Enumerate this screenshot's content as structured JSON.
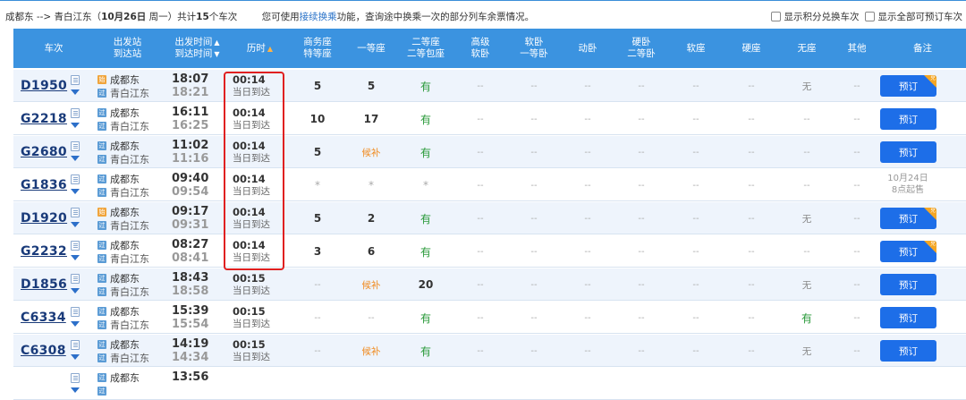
{
  "top": {
    "route_prefix": "成都东 --> 青白江东（",
    "route_date": "10月26日",
    "route_mid": " 周一）共计",
    "route_count": "15",
    "route_suffix": "个车次",
    "notice_prefix": "您可使用",
    "notice_link": "接续换乘",
    "notice_suffix": "功能，查询途中换乘一次的部分列车余票情况。",
    "opt_points": "显示积分兑换车次",
    "opt_all": "显示全部可预订车次"
  },
  "headers": {
    "train": "车次",
    "station_1": "出发站",
    "station_2": "到达站",
    "time_1": "出发时间",
    "time_2": "到达时间",
    "duration": "历时",
    "business_1": "商务座",
    "business_2": "特等座",
    "first": "一等座",
    "second_1": "二等座",
    "second_2": "二等包座",
    "advsoft_1": "高级",
    "advsoft_2": "软卧",
    "softsleep_1": "软卧",
    "softsleep_2": "一等卧",
    "moving": "动卧",
    "hardsleep_1": "硬卧",
    "hardsleep_2": "二等卧",
    "softseat": "软座",
    "hardseat": "硬座",
    "noseat": "无座",
    "other": "其他",
    "remark": "备注"
  },
  "icons": {
    "start_badge": "始",
    "pass_badge": "过",
    "points_corner": "兑"
  },
  "rows": [
    {
      "train": "D1950",
      "from": "成都东",
      "to": "青白江东",
      "from_type": "start",
      "dep": "18:07",
      "arr": "18:21",
      "dur": "00:14",
      "arrive": "当日到达",
      "seats": [
        "5",
        "5",
        "有",
        "--",
        "--",
        "--",
        "--",
        "--",
        "--",
        "无",
        "--"
      ],
      "action": "预订",
      "points": true
    },
    {
      "train": "G2218",
      "from": "成都东",
      "to": "青白江东",
      "from_type": "pass",
      "dep": "16:11",
      "arr": "16:25",
      "dur": "00:14",
      "arrive": "当日到达",
      "seats": [
        "10",
        "17",
        "有",
        "--",
        "--",
        "--",
        "--",
        "--",
        "--",
        "--",
        "--"
      ],
      "action": "预订",
      "points": false
    },
    {
      "train": "G2680",
      "from": "成都东",
      "to": "青白江东",
      "from_type": "pass",
      "dep": "11:02",
      "arr": "11:16",
      "dur": "00:14",
      "arrive": "当日到达",
      "seats": [
        "5",
        "候补",
        "有",
        "--",
        "--",
        "--",
        "--",
        "--",
        "--",
        "--",
        "--"
      ],
      "action": "预订",
      "points": false
    },
    {
      "train": "G1836",
      "from": "成都东",
      "to": "青白江东",
      "from_type": "pass",
      "dep": "09:40",
      "arr": "09:54",
      "dur": "00:14",
      "arrive": "当日到达",
      "seats": [
        "*",
        "*",
        "*",
        "--",
        "--",
        "--",
        "--",
        "--",
        "--",
        "--",
        "--"
      ],
      "action": "",
      "presale_1": "10月24日",
      "presale_2": "8点起售",
      "points": false
    },
    {
      "train": "D1920",
      "from": "成都东",
      "to": "青白江东",
      "from_type": "start",
      "dep": "09:17",
      "arr": "09:31",
      "dur": "00:14",
      "arrive": "当日到达",
      "seats": [
        "5",
        "2",
        "有",
        "--",
        "--",
        "--",
        "--",
        "--",
        "--",
        "无",
        "--"
      ],
      "action": "预订",
      "points": true
    },
    {
      "train": "G2232",
      "from": "成都东",
      "to": "青白江东",
      "from_type": "pass",
      "dep": "08:27",
      "arr": "08:41",
      "dur": "00:14",
      "arrive": "当日到达",
      "seats": [
        "3",
        "6",
        "有",
        "--",
        "--",
        "--",
        "--",
        "--",
        "--",
        "--",
        "--"
      ],
      "action": "预订",
      "points": true
    },
    {
      "train": "D1856",
      "from": "成都东",
      "to": "青白江东",
      "from_type": "pass",
      "dep": "18:43",
      "arr": "18:58",
      "dur": "00:15",
      "arrive": "当日到达",
      "seats": [
        "--",
        "候补",
        "20",
        "--",
        "--",
        "--",
        "--",
        "--",
        "--",
        "无",
        "--"
      ],
      "action": "预订",
      "points": false
    },
    {
      "train": "C6334",
      "from": "成都东",
      "to": "青白江东",
      "from_type": "pass",
      "dep": "15:39",
      "arr": "15:54",
      "dur": "00:15",
      "arrive": "当日到达",
      "seats": [
        "--",
        "--",
        "有",
        "--",
        "--",
        "--",
        "--",
        "--",
        "--",
        "有",
        "--"
      ],
      "action": "预订",
      "points": false
    },
    {
      "train": "C6308",
      "from": "成都东",
      "to": "青白江东",
      "from_type": "pass",
      "dep": "14:19",
      "arr": "14:34",
      "dur": "00:15",
      "arrive": "当日到达",
      "seats": [
        "--",
        "候补",
        "有",
        "--",
        "--",
        "--",
        "--",
        "--",
        "--",
        "无",
        "--"
      ],
      "action": "预订",
      "points": false
    },
    {
      "train": "",
      "from": "成都东",
      "to": "",
      "from_type": "pass",
      "dep": "13:56",
      "arr": "",
      "dur": "",
      "arrive": "",
      "seats": [
        "",
        "",
        "",
        "",
        "",
        "",
        "",
        "",
        "",
        "",
        ""
      ],
      "action": "",
      "points": false
    }
  ],
  "colors": {
    "header_bg": "#3b93e0",
    "button": "#1d6ee8",
    "highlight": "#e02020",
    "available": "#2a9a3a",
    "waitlist": "#f08a1e"
  }
}
